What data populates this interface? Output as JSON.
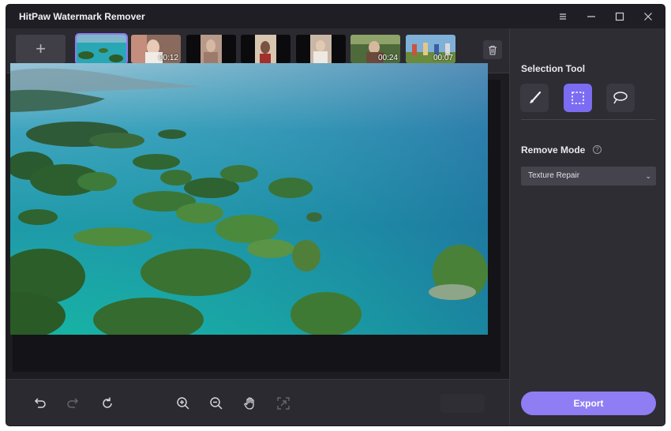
{
  "app": {
    "title": "HitPaw Watermark Remover"
  },
  "window_controls": {
    "menu_icon": "menu-icon",
    "minimize_icon": "minimize-icon",
    "maximize_icon": "maximize-icon",
    "close_icon": "close-icon"
  },
  "thumbnails": {
    "add_label": "+",
    "items": [
      {
        "duration": ""
      },
      {
        "duration": "00:12"
      },
      {
        "duration": ""
      },
      {
        "duration": ""
      },
      {
        "duration": ""
      },
      {
        "duration": "00:24"
      },
      {
        "duration": "00:07"
      }
    ],
    "delete_icon": "trash-icon"
  },
  "toolbar": {
    "icons": [
      "undo-icon",
      "redo-icon",
      "refresh-icon",
      "zoom-in-icon",
      "zoom-out-icon",
      "hand-icon",
      "fit-screen-icon"
    ]
  },
  "sidebar": {
    "selection_tool_label": "Selection Tool",
    "tools": [
      "brush-icon",
      "rectangle-select-icon",
      "lasso-icon"
    ],
    "remove_mode_label": "Remove Mode",
    "help_symbol": "?",
    "remove_mode_value": "Texture Repair",
    "export_label": "Export"
  },
  "colors": {
    "accent": "#8e7df3",
    "panel": "#2e2d34",
    "background": "#26252c"
  }
}
